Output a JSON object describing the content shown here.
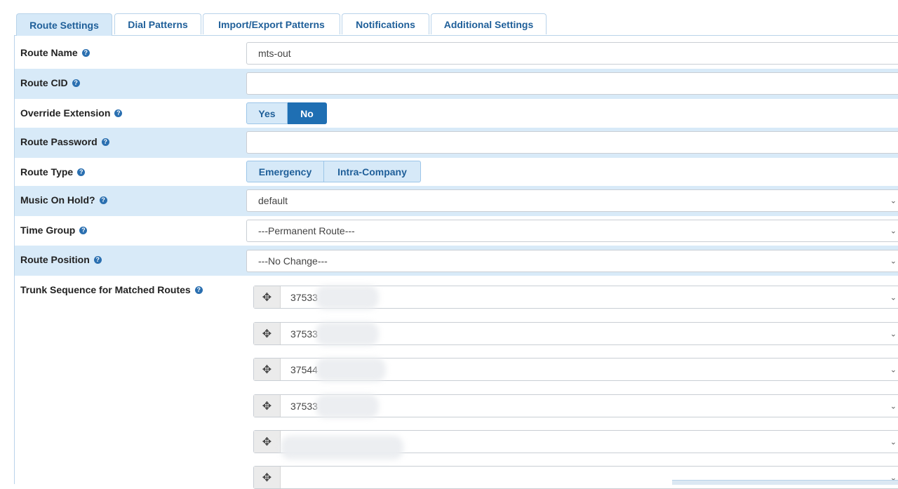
{
  "tabs": [
    {
      "label": "Route Settings"
    },
    {
      "label": "Dial Patterns"
    },
    {
      "label": "Import/Export Patterns"
    },
    {
      "label": "Notifications"
    },
    {
      "label": "Additional Settings"
    }
  ],
  "fields": {
    "route_name": {
      "label": "Route Name",
      "value": "mts-out"
    },
    "route_cid": {
      "label": "Route CID",
      "value": ""
    },
    "override_extension": {
      "label": "Override Extension",
      "yes": "Yes",
      "no": "No"
    },
    "route_password": {
      "label": "Route Password",
      "value": ""
    },
    "route_type": {
      "label": "Route Type",
      "emergency": "Emergency",
      "intra": "Intra-Company"
    },
    "music_on_hold": {
      "label": "Music On Hold?",
      "value": "default"
    },
    "time_group": {
      "label": "Time Group",
      "value": "---Permanent Route---"
    },
    "route_position": {
      "label": "Route Position",
      "value": "---No Change---"
    },
    "trunk_sequence": {
      "label": "Trunk Sequence for Matched Routes"
    }
  },
  "trunks": [
    {
      "value": "37533"
    },
    {
      "value": "37533"
    },
    {
      "value": "37544"
    },
    {
      "value": "37533"
    },
    {
      "value": ""
    },
    {
      "value": ""
    }
  ],
  "icons": {
    "help": "?",
    "drag": "✥",
    "chevron": "⌄"
  },
  "colors": {
    "accent": "#1f6fb3",
    "row_alt": "#d8eaf8",
    "tab_text": "#1f5f99"
  }
}
